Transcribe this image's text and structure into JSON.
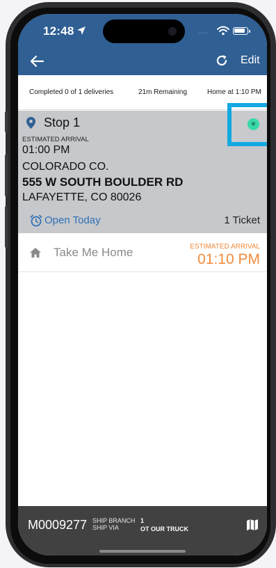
{
  "status_bar": {
    "time": "12:48",
    "signal_dots": "...."
  },
  "nav": {
    "edit_label": "Edit"
  },
  "summary": {
    "completed": "Completed 0 of 1 deliveries",
    "remaining": "21m Remaining",
    "home_at": "Home at 1:10 PM"
  },
  "stop": {
    "title": "Stop 1",
    "estimated_label": "ESTIMATED ARRIVAL",
    "estimated_time": "01:00 PM",
    "customer": "COLORADO CO.",
    "street": "555 W SOUTH BOULDER RD",
    "city": "LAFAYETTE, CO 80026",
    "open_status": "Open Today",
    "tickets": "1 Ticket"
  },
  "home_row": {
    "label": "Take Me Home",
    "estimated_label": "ESTIMATED ARRIVAL",
    "estimated_time": "01:10 PM"
  },
  "bottom_bar": {
    "order_id": "M0009277",
    "ship_branch_label": "SHIP BRANCH",
    "ship_branch_value": "1",
    "ship_via_label": "SHIP VIA",
    "ship_via_value": "OT OUR TRUCK"
  },
  "colors": {
    "appbar": "#2f5f93",
    "stop_card": "#c6c8cb",
    "accent_orange": "#f08a3a",
    "link_blue": "#2f6fb5",
    "highlight": "#13a8e0",
    "badge_green": "#2fd6a4",
    "bottom_bar": "#414141"
  },
  "icons": {
    "back": "arrow-left-icon",
    "refresh": "refresh-icon",
    "pin": "map-pin-icon",
    "clock": "alarm-clock-icon",
    "star": "star-icon",
    "home": "home-icon",
    "map": "map-icon"
  }
}
